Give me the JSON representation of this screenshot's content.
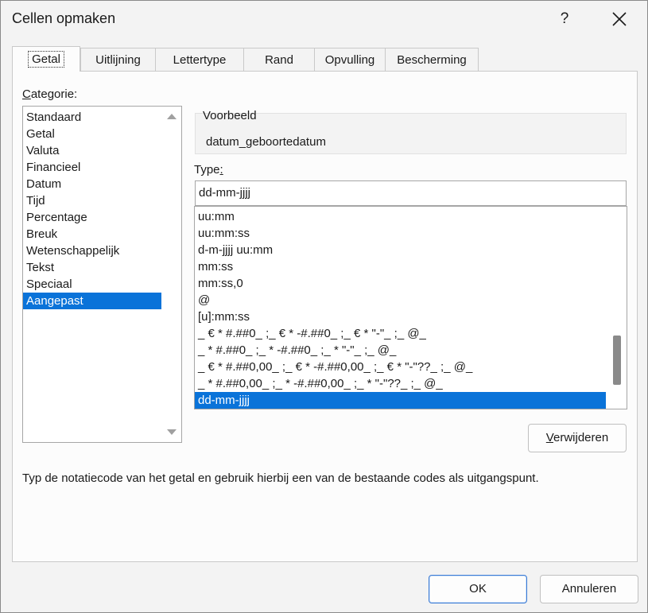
{
  "window": {
    "title": "Cellen opmaken",
    "help_label": "?"
  },
  "tabs": [
    {
      "label": "Getal"
    },
    {
      "label": "Uitlijning"
    },
    {
      "label": "Lettertype"
    },
    {
      "label": "Rand"
    },
    {
      "label": "Opvulling"
    },
    {
      "label": "Bescherming"
    }
  ],
  "category": {
    "label_first": "C",
    "label_rest": "ategorie:",
    "items": [
      "Standaard",
      "Getal",
      "Valuta",
      "Financieel",
      "Datum",
      "Tijd",
      "Percentage",
      "Breuk",
      "Wetenschappelijk",
      "Tekst",
      "Speciaal",
      "Aangepast"
    ],
    "selected": "Aangepast"
  },
  "sample": {
    "legend": "Voorbeeld",
    "value": "datum_geboortedatum"
  },
  "type": {
    "label_first": "Type",
    "label_underlined": ":",
    "value": "dd-mm-jjjj",
    "items": [
      "uu:mm",
      "uu:mm:ss",
      "d-m-jjjj uu:mm",
      "mm:ss",
      "mm:ss,0",
      "@",
      "[u]:mm:ss",
      "_ € * #.##0_ ;_ € * -#.##0_ ;_ € * \"-\"_ ;_ @_",
      "_ * #.##0_ ;_ * -#.##0_ ;_ * \"-\"_ ;_ @_",
      "_ € * #.##0,00_ ;_ € * -#.##0,00_ ;_ € * \"-\"??_ ;_ @_",
      "_ * #.##0,00_ ;_ * -#.##0,00_ ;_ * \"-\"??_ ;_ @_",
      "dd-mm-jjjj"
    ],
    "selected": "dd-mm-jjjj"
  },
  "delete_button": {
    "first": "V",
    "rest": "erwijderen"
  },
  "hint": "Typ de notatiecode van het getal en gebruik hierbij een van de bestaande codes als uitgangspunt.",
  "footer": {
    "ok_label": "OK",
    "cancel_label": "Annuleren"
  },
  "colors": {
    "selection": "#0a73d9",
    "background": "#f3f3f3",
    "panel": "#fcfcfc"
  }
}
